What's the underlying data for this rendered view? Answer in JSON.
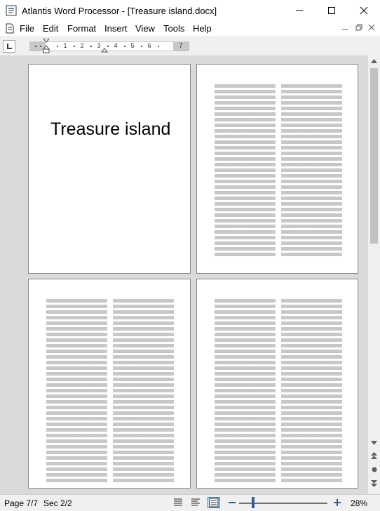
{
  "window": {
    "title": "Atlantis Word Processor - [Treasure island.docx]"
  },
  "menu": {
    "items": [
      "File",
      "Edit",
      "Format",
      "Insert",
      "View",
      "Tools",
      "Help"
    ]
  },
  "ruler": {
    "numbers": [
      "1",
      "2",
      "3",
      "4",
      "5",
      "6",
      "7"
    ]
  },
  "document": {
    "heading": "Treasure island"
  },
  "status": {
    "page": "Page 7/7",
    "section": "Sec 2/2",
    "zoom": "28%",
    "zoom_level": 0.28
  },
  "colors": {
    "accent": "#2a5d9e",
    "workspace": "#dadada",
    "active_view": "#cce4f7"
  },
  "icons": {
    "app": "atlantis-app-icon",
    "minimize": "minimize-icon",
    "maximize": "maximize-icon",
    "close": "close-icon",
    "doc": "document-icon",
    "tab_stop": "left-tab-stop-icon",
    "indent": "indent-marker-icon",
    "scroll_up": "arrow-up-icon",
    "scroll_down": "arrow-down-icon",
    "prev_page": "double-arrow-up-icon",
    "browse": "browse-object-icon",
    "next_page": "double-arrow-down-icon",
    "zoom_out": "minus-icon",
    "zoom_in": "plus-icon"
  }
}
